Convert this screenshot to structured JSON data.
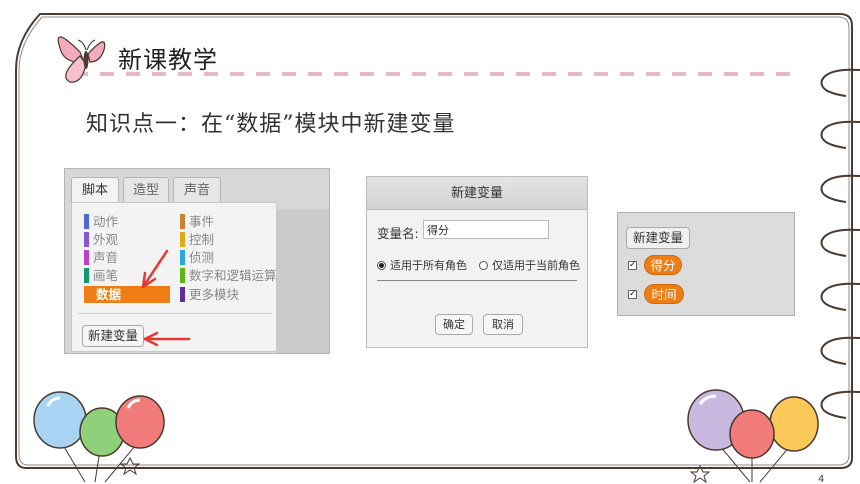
{
  "slide": {
    "title": "新课教学",
    "subtitle": "知识点一：在“数据”模块中新建变量",
    "page_number": "4"
  },
  "palette": {
    "tabs": [
      {
        "label": "脚本",
        "active": true
      },
      {
        "label": "造型",
        "active": false
      },
      {
        "label": "声音",
        "active": false
      }
    ],
    "categories_left": [
      {
        "label": "动作",
        "color": "#4a6cd4"
      },
      {
        "label": "外观",
        "color": "#8a55d7"
      },
      {
        "label": "声音",
        "color": "#bb42c3"
      },
      {
        "label": "画笔",
        "color": "#0e9a6c"
      },
      {
        "label": "数据",
        "color": "#ee7d16",
        "selected": true
      }
    ],
    "categories_right": [
      {
        "label": "事件",
        "color": "#c88330"
      },
      {
        "label": "控制",
        "color": "#e1a91a"
      },
      {
        "label": "侦测",
        "color": "#2ca5e2"
      },
      {
        "label": "数字和逻辑运算",
        "color": "#5cb712"
      },
      {
        "label": "更多模块",
        "color": "#632d99"
      }
    ],
    "new_variable_button": "新建变量"
  },
  "dialog": {
    "title": "新建变量",
    "name_label": "变量名:",
    "name_value": "得分",
    "radio_all": "适用于所有角色",
    "radio_current": "仅适用于当前角色",
    "radio_selected": "all",
    "ok_label": "确定",
    "cancel_label": "取消"
  },
  "stage_vars": {
    "new_variable_button": "新建变量",
    "variables": [
      {
        "name": "得分",
        "checked": true
      },
      {
        "name": "时间",
        "checked": true
      }
    ]
  },
  "colors": {
    "data_orange": "#ee7d16",
    "arrow_red": "#e53935",
    "frame_brown": "#4a3a30"
  },
  "icons": [
    "butterfly-icon",
    "balloons-left-icon",
    "balloons-right-icon",
    "radio-icon",
    "checkbox-icon"
  ]
}
